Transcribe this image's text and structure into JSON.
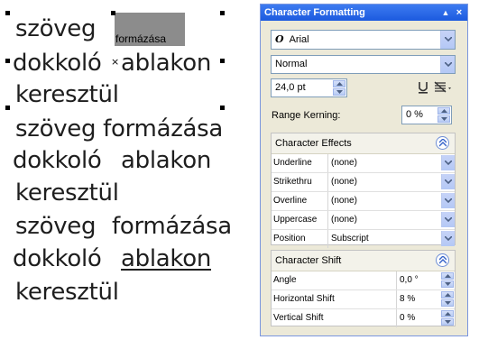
{
  "canvas": {
    "block1": {
      "line1_word": "szöveg",
      "line1_selected": "formázása",
      "line2_a": "dokkoló",
      "line2_b": "ablakon",
      "line3": "keresztül"
    },
    "block2": {
      "line1": "szöveg formázása",
      "line2_a": "dokkoló",
      "line2_b": "ablakon",
      "line3": "keresztül"
    },
    "block3": {
      "line1_a": "szöveg",
      "line1_b": "formázása",
      "line2_a": "dokkoló",
      "line2_b": "ablakon",
      "line3": "keresztül"
    }
  },
  "docker": {
    "title": "Character Formatting",
    "font": {
      "icon": "opentype-icon",
      "glyph": "O",
      "value": "Arial"
    },
    "style": "Normal",
    "size": "24,0 pt",
    "range_kerning_label": "Range Kerning:",
    "range_kerning_value": "0 %",
    "character_effects": {
      "title": "Character Effects",
      "rows": [
        {
          "name": "Underline",
          "value": "(none)"
        },
        {
          "name": "Strikethru",
          "value": "(none)"
        },
        {
          "name": "Overline",
          "value": "(none)"
        },
        {
          "name": "Uppercase",
          "value": "(none)"
        },
        {
          "name": "Position",
          "value": "Subscript"
        }
      ]
    },
    "character_shift": {
      "title": "Character Shift",
      "rows": [
        {
          "name": "Angle",
          "value": "0,0 °"
        },
        {
          "name": "Horizontal Shift",
          "value": "8 %"
        },
        {
          "name": "Vertical Shift",
          "value": "0 %"
        }
      ]
    }
  }
}
